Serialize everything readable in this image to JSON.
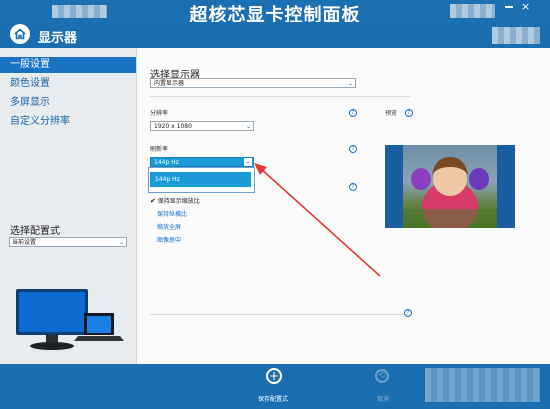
{
  "app": {
    "title": "超核芯显卡控制面板"
  },
  "window": {
    "close_glyph": "×"
  },
  "header": {
    "section_title": "显示器"
  },
  "sidebar": {
    "items": [
      {
        "label": "一般设置",
        "active": true
      },
      {
        "label": "颜色设置",
        "active": false
      },
      {
        "label": "多屏显示",
        "active": false
      },
      {
        "label": "自定义分辨率",
        "active": false
      }
    ],
    "profile_label": "选择配置式",
    "profile_value": "当前设置"
  },
  "main": {
    "select_display_label": "选择显示器",
    "display_value": "内置显示器",
    "resolution_label": "分辨率",
    "resolution_value": "1920 x 1080",
    "refresh_label": "刷新率",
    "refresh_value": "144p Hz",
    "refresh_options": [
      "144p Hz"
    ],
    "preview_label": "预览",
    "scaling": {
      "checkbox_label": "保持显示缩放比",
      "options": [
        "保持纵横比",
        "缩放全屏",
        "图像居中"
      ]
    }
  },
  "footer": {
    "save_label": "保存配置式",
    "cancel_label": "取消"
  },
  "colors": {
    "accent": "#1a73c4",
    "header_bg": "#1b6fb1",
    "arrow": "#e53935"
  },
  "icons": {
    "home": "home-icon",
    "help": "help-icon",
    "save": "plus-circle-icon",
    "cancel": "cancel-icon"
  }
}
